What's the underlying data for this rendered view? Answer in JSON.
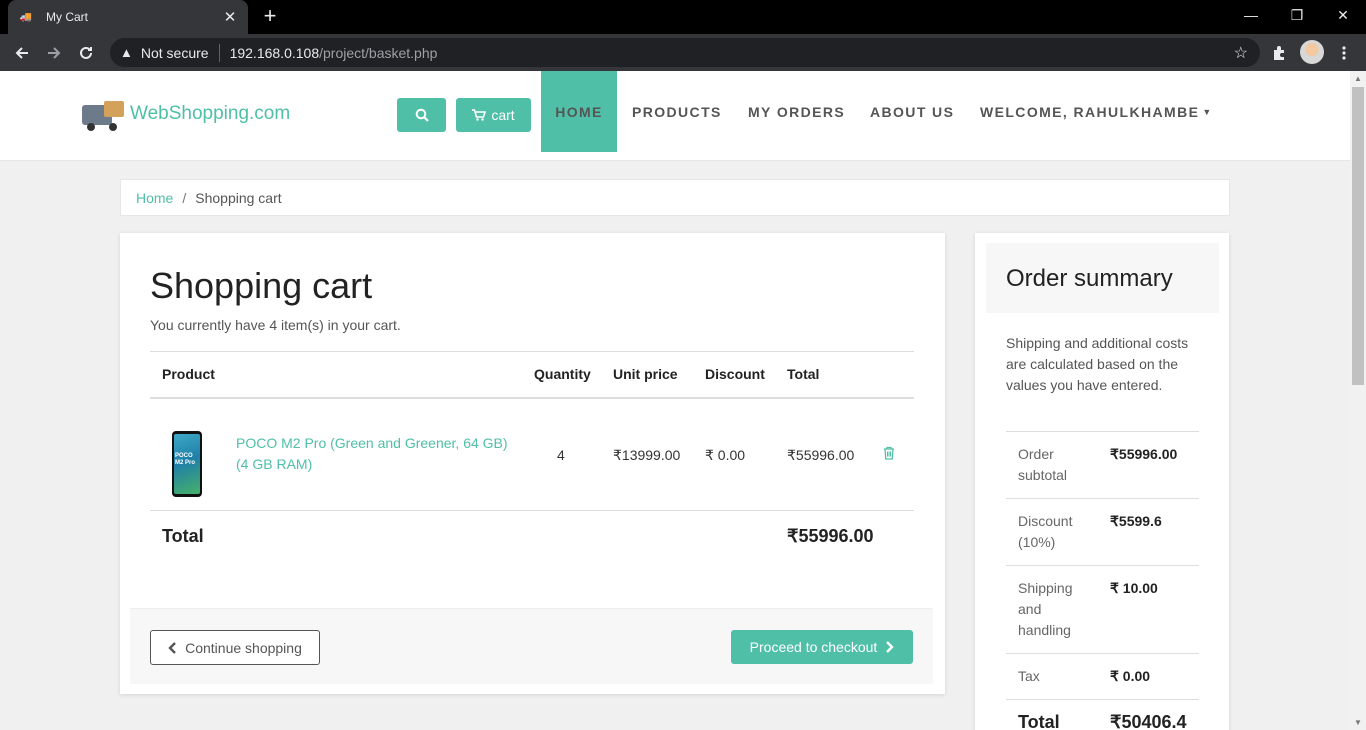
{
  "browser": {
    "tab_title": "My Cart",
    "tab_close": "✕",
    "new_tab": "+",
    "not_secure": "Not secure",
    "url_host": "192.168.0.108",
    "url_path": "/project/basket.php",
    "win_minimize": "—",
    "win_restore": "❐",
    "win_close": "✕"
  },
  "site": {
    "logo_text": "WebShopping.com",
    "cart_label": "cart",
    "nav": [
      "HOME",
      "PRODUCTS",
      "MY ORDERS",
      "ABOUT US",
      "WELCOME, RAHULKHAMBE"
    ]
  },
  "breadcrumb": {
    "home": "Home",
    "sep": "/",
    "current": "Shopping cart"
  },
  "cart": {
    "title": "Shopping cart",
    "count_text": "You currently have 4 item(s) in your cart.",
    "headers": {
      "product": "Product",
      "quantity": "Quantity",
      "unit_price": "Unit price",
      "discount": "Discount",
      "total": "Total"
    },
    "item": {
      "phone_label": "POCO M2 Pro",
      "name": "POCO M2 Pro (Green and Greener, 64 GB) (4 GB RAM)",
      "quantity": "4",
      "unit_price": "₹13999.00",
      "discount": "₹ 0.00",
      "total": "₹55996.00"
    },
    "total_label": "Total",
    "total_value": "₹55996.00",
    "continue_label": "Continue shopping",
    "checkout_label": "Proceed to checkout"
  },
  "summary": {
    "title": "Order summary",
    "note": "Shipping and additional costs are calculated based on the values you have entered.",
    "rows": [
      {
        "label": "Order subtotal",
        "value": "₹55996.00"
      },
      {
        "label": "Discount (10%)",
        "value": "₹5599.6"
      },
      {
        "label": "Shipping and handling",
        "value": "₹ 10.00"
      },
      {
        "label": "Tax",
        "value": "₹ 0.00"
      },
      {
        "label": "Total",
        "value": "₹50406.4"
      }
    ]
  },
  "colors": {
    "accent": "#4fbfa8"
  },
  "icons": [
    "search-icon",
    "cart-icon",
    "trash-icon",
    "chevron-left-icon",
    "chevron-right-icon",
    "star-icon",
    "puzzle-icon",
    "menu-dots-icon",
    "back-icon",
    "forward-icon",
    "reload-icon",
    "warning-icon"
  ]
}
